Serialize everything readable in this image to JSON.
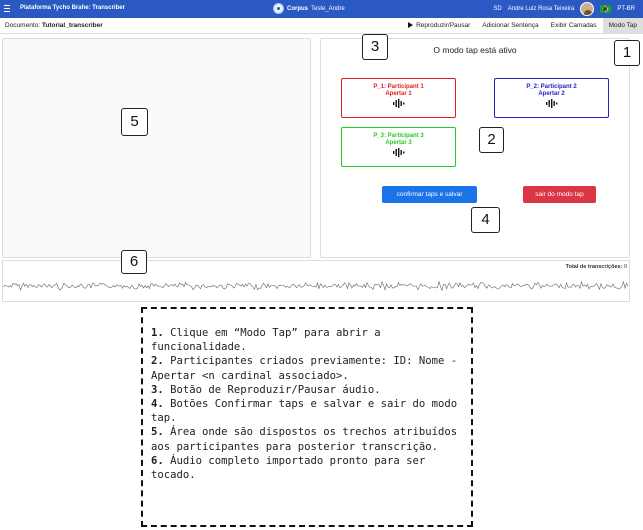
{
  "navbar": {
    "brand": "Plataforma Tycho Brahe: Transcriber",
    "corpus_label": "Corpus",
    "corpus_name": "Teste_Andre",
    "user_initials": "SD",
    "user_name": "Andre Luiz Rosa Teixeira",
    "language": "PT-BR",
    "color": "#2b59c3"
  },
  "docbar": {
    "document_label": "Documento:",
    "document_name": "Tutorial_transcriber",
    "toolbar": {
      "play_pause": "Reproduzir/Pausar",
      "add_sentence": "Adicionar Sentença",
      "show_layers": "Exibir Camadas",
      "tap_mode": "Modo Tap"
    }
  },
  "tap_panel": {
    "status": "O modo tap está ativo",
    "participants": [
      {
        "name": "P_1: Participant 1",
        "key": "Apertar 1",
        "color": "#e02020"
      },
      {
        "name": "P_2: Participant 2",
        "key": "Apertar 2",
        "color": "#2222cc"
      },
      {
        "name": "P_3: Participant 3",
        "key": "Apertar 3",
        "color": "#22cc22"
      }
    ],
    "confirm_button": "confirmar taps e salvar",
    "exit_button": "sair do modo tap"
  },
  "waveform": {
    "total_label": "Total de transcrições:",
    "total_value": "0"
  },
  "callouts": [
    "1",
    "2",
    "3",
    "4",
    "5",
    "6"
  ],
  "legend": {
    "items": [
      {
        "num": "1.",
        "text": " Clique em “Modo Tap” para abrir a funcionalidade."
      },
      {
        "num": "2.",
        "text": " Participantes criados previamente: ID: Nome - Apertar <n cardinal associado>."
      },
      {
        "num": "3.",
        "text": " Botão de Reproduzir/Pausar áudio."
      },
      {
        "num": "4.",
        "text": " Botões Confirmar taps e salvar e sair do modo tap."
      },
      {
        "num": "5.",
        "text": " Área onde são dispostos os trechos atribuídos aos participantes para posterior transcrição."
      },
      {
        "num": "6.",
        "text": " Áudio completo importado pronto para ser tocado."
      }
    ]
  }
}
